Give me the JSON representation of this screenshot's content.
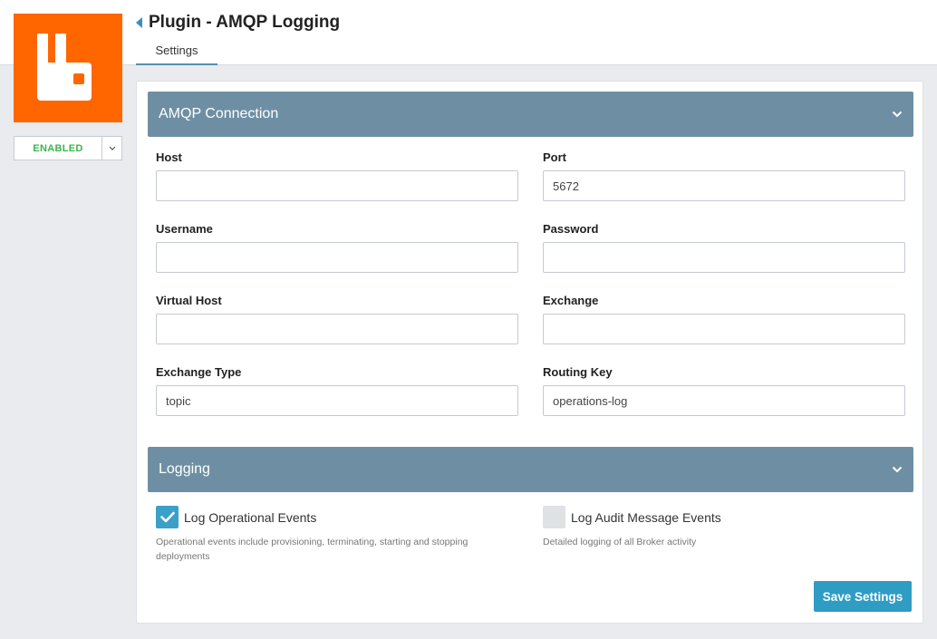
{
  "plugin": {
    "title": "Plugin - AMQP Logging",
    "status": "ENABLED",
    "logo_icon": "rabbitmq-logo-icon",
    "brand_color": "#ff6600",
    "status_color": "#3bb54a"
  },
  "tabs": [
    {
      "label": "Settings",
      "active": true
    }
  ],
  "sections": {
    "connection": {
      "title": "AMQP Connection",
      "fields": {
        "host": {
          "label": "Host",
          "value": ""
        },
        "port": {
          "label": "Port",
          "value": "5672"
        },
        "username": {
          "label": "Username",
          "value": ""
        },
        "password": {
          "label": "Password",
          "value": ""
        },
        "virtual_host": {
          "label": "Virtual Host",
          "value": ""
        },
        "exchange": {
          "label": "Exchange",
          "value": ""
        },
        "exchange_type": {
          "label": "Exchange Type",
          "value": "topic"
        },
        "routing_key": {
          "label": "Routing Key",
          "value": "operations-log"
        }
      }
    },
    "logging": {
      "title": "Logging",
      "operational": {
        "label": "Log Operational Events",
        "checked": true,
        "help": "Operational events include provisioning, terminating, starting and stopping deployments"
      },
      "audit": {
        "label": "Log Audit Message Events",
        "checked": false,
        "help": "Detailed logging of all Broker activity"
      }
    }
  },
  "actions": {
    "save_label": "Save Settings"
  },
  "colors": {
    "section_header": "#6e8fa3",
    "accent": "#2f9cc4",
    "checkbox_on": "#3aa0c8"
  }
}
